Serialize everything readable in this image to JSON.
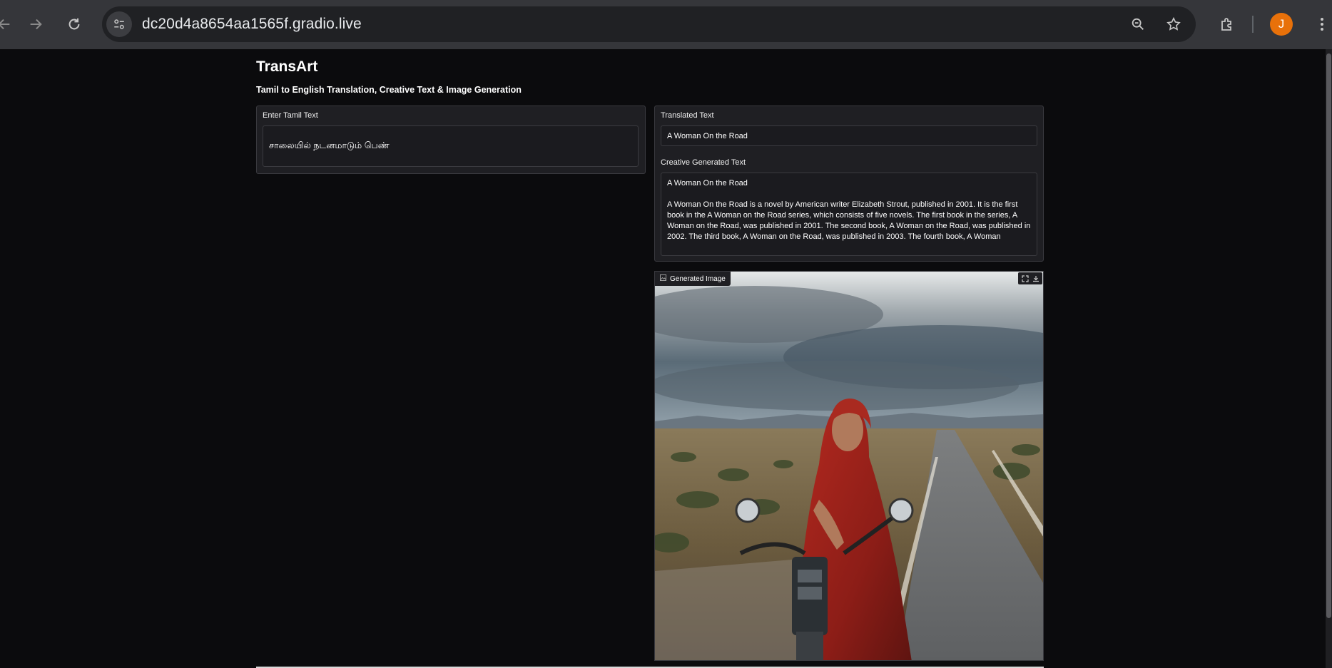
{
  "browser": {
    "url": "dc20d4a8654aa1565f.gradio.live",
    "profile_initial": "J",
    "icons": [
      "back-arrow-icon",
      "forward-arrow-icon",
      "reload-icon",
      "site-info-icon",
      "zoom-icon",
      "bookmark-star-icon",
      "extensions-puzzle-icon",
      "menu-kebab-icon"
    ]
  },
  "app": {
    "title": "TransArt",
    "subtitle": "Tamil to English Translation, Creative Text & Image Generation"
  },
  "input_panel": {
    "label": "Enter Tamil Text",
    "value": "சாலையில் நடனமாடும் பெண்"
  },
  "output_panel": {
    "translated_label": "Translated Text",
    "translated_value": "A Woman On the Road",
    "creative_label": "Creative Generated Text",
    "creative_title": "A Woman On the Road",
    "creative_body": "A Woman On the Road is a novel by American writer Elizabeth Strout, published in 2001. It is the first book in the A Woman on the Road series, which consists of five novels. The first book in the series, A Woman on the Road, was published in 2001. The second book, A Woman on the Road, was published in 2002. The third book, A Woman on the Road, was published in 2003. The fourth book, A Woman"
  },
  "image_panel": {
    "label": "Generated Image",
    "tools": [
      "fullscreen-icon",
      "download-icon"
    ]
  },
  "colors": {
    "page_bg": "#0b0b0d",
    "panel_bg": "#1f1f23",
    "chrome_bg": "#35363a",
    "avatar": "#e8710a"
  }
}
